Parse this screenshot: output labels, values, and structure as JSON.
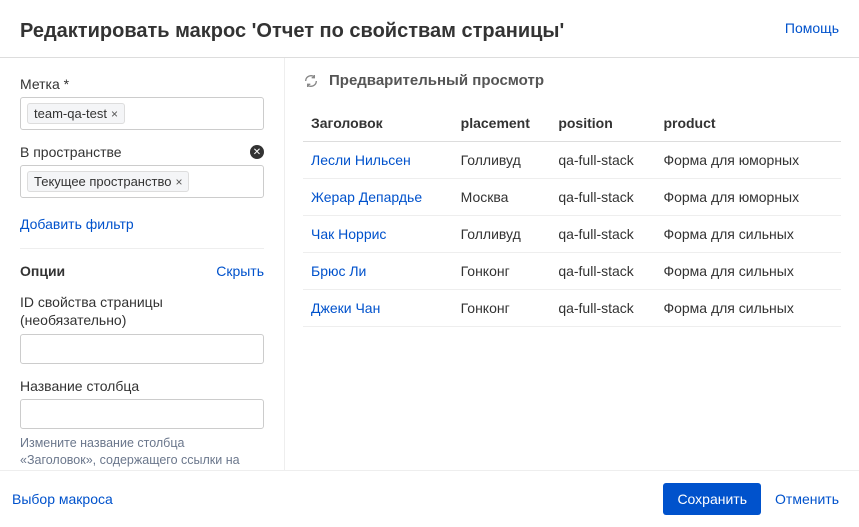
{
  "header": {
    "title": "Редактировать макрос 'Отчет по свойствам страницы'",
    "help": "Помощь"
  },
  "sidebar": {
    "label_field": {
      "label": "Метка *",
      "tokens": [
        "team-qa-test"
      ]
    },
    "space_field": {
      "label": "В пространстве",
      "tokens": [
        "Текущее пространство"
      ]
    },
    "add_filter": "Добавить фильтр",
    "options": {
      "title": "Опции",
      "hide": "Скрыть",
      "prop_id_label": "ID свойства страницы (необязательно)",
      "prop_id_value": "",
      "column_label": "Название столбца",
      "column_value": "",
      "hint": "Измените название столбца «Заголовок», содержащего ссылки на страницы."
    }
  },
  "preview": {
    "title": "Предварительный просмотр",
    "columns": [
      "Заголовок",
      "placement",
      "position",
      "product"
    ],
    "rows": [
      {
        "title": "Лесли Нильсен",
        "placement": "Голливуд",
        "position": "qa-full-stack",
        "product": "Форма для юморных"
      },
      {
        "title": "Жерар Депардье",
        "placement": "Москва",
        "position": "qa-full-stack",
        "product": "Форма для юморных"
      },
      {
        "title": "Чак Норрис",
        "placement": "Голливуд",
        "position": "qa-full-stack",
        "product": "Форма для сильных"
      },
      {
        "title": "Брюс Ли",
        "placement": "Гонконг",
        "position": "qa-full-stack",
        "product": "Форма для сильных"
      },
      {
        "title": "Джеки Чан",
        "placement": "Гонконг",
        "position": "qa-full-stack",
        "product": "Форма для сильных"
      }
    ]
  },
  "footer": {
    "choose_macro": "Выбор макроса",
    "save": "Сохранить",
    "cancel": "Отменить"
  }
}
